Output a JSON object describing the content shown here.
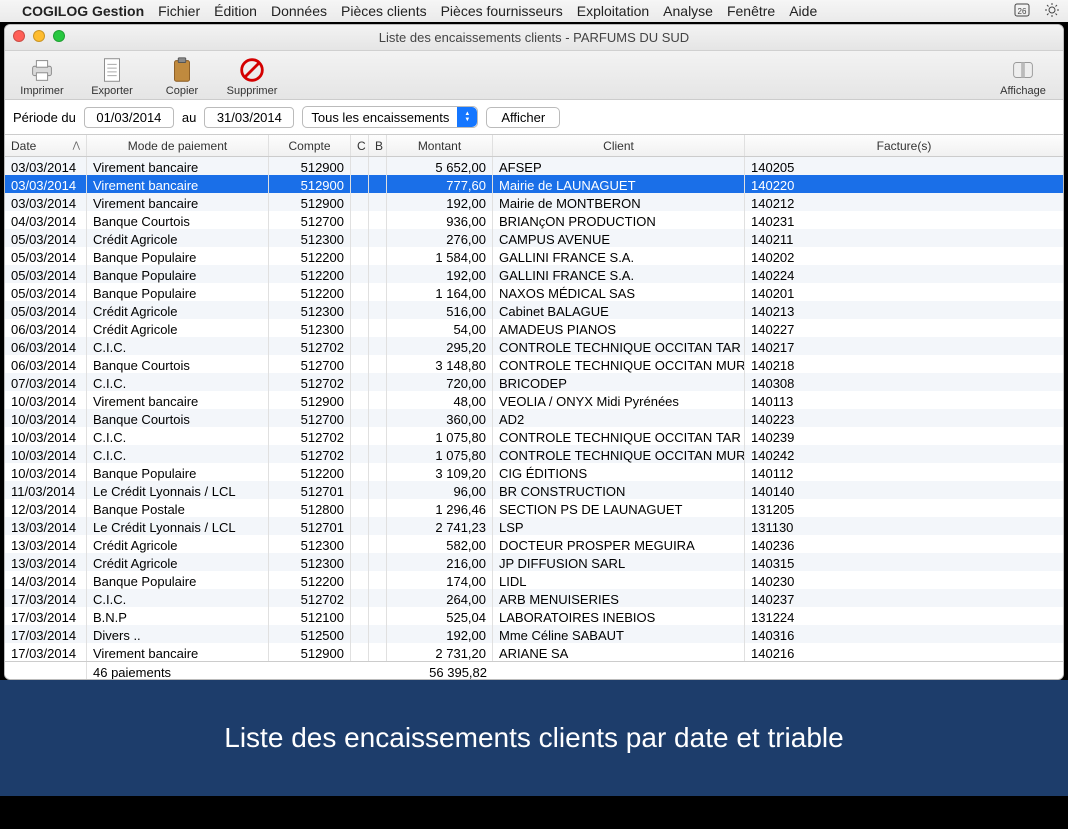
{
  "menubar": {
    "app": "COGILOG Gestion",
    "items": [
      "Fichier",
      "Édition",
      "Données",
      "Pièces clients",
      "Pièces fournisseurs",
      "Exploitation",
      "Analyse",
      "Fenêtre",
      "Aide"
    ]
  },
  "window": {
    "title": "Liste des encaissements clients - PARFUMS DU SUD"
  },
  "toolbar": {
    "print": "Imprimer",
    "export": "Exporter",
    "copy": "Copier",
    "delete": "Supprimer",
    "display": "Affichage"
  },
  "filters": {
    "label_from": "Période du",
    "date_from": "01/03/2014",
    "label_to": "au",
    "date_to": "31/03/2014",
    "filter_value": "Tous les encaissements",
    "show_btn": "Afficher"
  },
  "columns": {
    "date": "Date",
    "mode": "Mode de paiement",
    "compte": "Compte",
    "c": "C",
    "b": "B",
    "montant": "Montant",
    "client": "Client",
    "factures": "Facture(s)"
  },
  "rows": [
    {
      "date": "03/03/2014",
      "mode": "Virement bancaire",
      "compte": "512900",
      "montant": "5 652,00",
      "client": "AFSEP",
      "fact": "140205",
      "sel": false
    },
    {
      "date": "03/03/2014",
      "mode": "Virement bancaire",
      "compte": "512900",
      "montant": "777,60",
      "client": "Mairie de LAUNAGUET",
      "fact": "140220",
      "sel": true
    },
    {
      "date": "03/03/2014",
      "mode": "Virement bancaire",
      "compte": "512900",
      "montant": "192,00",
      "client": "Mairie de MONTBERON",
      "fact": "140212",
      "sel": false
    },
    {
      "date": "04/03/2014",
      "mode": "Banque Courtois",
      "compte": "512700",
      "montant": "936,00",
      "client": "BRIANçON PRODUCTION",
      "fact": "140231",
      "sel": false
    },
    {
      "date": "05/03/2014",
      "mode": "Crédit Agricole",
      "compte": "512300",
      "montant": "276,00",
      "client": "CAMPUS AVENUE",
      "fact": "140211",
      "sel": false
    },
    {
      "date": "05/03/2014",
      "mode": "Banque Populaire",
      "compte": "512200",
      "montant": "1 584,00",
      "client": "GALLINI FRANCE S.A.",
      "fact": "140202",
      "sel": false
    },
    {
      "date": "05/03/2014",
      "mode": "Banque Populaire",
      "compte": "512200",
      "montant": "192,00",
      "client": "GALLINI FRANCE S.A.",
      "fact": "140224",
      "sel": false
    },
    {
      "date": "05/03/2014",
      "mode": "Banque Populaire",
      "compte": "512200",
      "montant": "1 164,00",
      "client": "NAXOS MÉDICAL SAS",
      "fact": "140201",
      "sel": false
    },
    {
      "date": "05/03/2014",
      "mode": "Crédit Agricole",
      "compte": "512300",
      "montant": "516,00",
      "client": "Cabinet  BALAGUE",
      "fact": "140213",
      "sel": false
    },
    {
      "date": "06/03/2014",
      "mode": "Crédit Agricole",
      "compte": "512300",
      "montant": "54,00",
      "client": "AMADEUS PIANOS",
      "fact": "140227",
      "sel": false
    },
    {
      "date": "06/03/2014",
      "mode": "C.I.C.",
      "compte": "512702",
      "montant": "295,20",
      "client": "CONTROLE TECHNIQUE OCCITAN TAR",
      "fact": "140217",
      "sel": false
    },
    {
      "date": "06/03/2014",
      "mode": "Banque Courtois",
      "compte": "512700",
      "montant": "3 148,80",
      "client": "CONTROLE TECHNIQUE OCCITAN MUR",
      "fact": "140218",
      "sel": false
    },
    {
      "date": "07/03/2014",
      "mode": "C.I.C.",
      "compte": "512702",
      "montant": "720,00",
      "client": "BRICODEP",
      "fact": "140308",
      "sel": false
    },
    {
      "date": "10/03/2014",
      "mode": "Virement bancaire",
      "compte": "512900",
      "montant": "48,00",
      "client": "VEOLIA / ONYX Midi Pyrénées",
      "fact": "140113",
      "sel": false
    },
    {
      "date": "10/03/2014",
      "mode": "Banque Courtois",
      "compte": "512700",
      "montant": "360,00",
      "client": "AD2",
      "fact": "140223",
      "sel": false
    },
    {
      "date": "10/03/2014",
      "mode": "C.I.C.",
      "compte": "512702",
      "montant": "1 075,80",
      "client": "CONTROLE TECHNIQUE OCCITAN TAR",
      "fact": "140239",
      "sel": false
    },
    {
      "date": "10/03/2014",
      "mode": "C.I.C.",
      "compte": "512702",
      "montant": "1 075,80",
      "client": "CONTROLE TECHNIQUE OCCITAN MUR",
      "fact": "140242",
      "sel": false
    },
    {
      "date": "10/03/2014",
      "mode": "Banque Populaire",
      "compte": "512200",
      "montant": "3 109,20",
      "client": "CIG ÉDITIONS",
      "fact": "140112",
      "sel": false
    },
    {
      "date": "11/03/2014",
      "mode": "Le Crédit Lyonnais / LCL",
      "compte": "512701",
      "montant": "96,00",
      "client": "BR CONSTRUCTION",
      "fact": "140140",
      "sel": false
    },
    {
      "date": "12/03/2014",
      "mode": "Banque Postale",
      "compte": "512800",
      "montant": "1 296,46",
      "client": "SECTION PS DE LAUNAGUET",
      "fact": "131205",
      "sel": false
    },
    {
      "date": "13/03/2014",
      "mode": "Le Crédit Lyonnais / LCL",
      "compte": "512701",
      "montant": "2 741,23",
      "client": "LSP",
      "fact": "131130",
      "sel": false
    },
    {
      "date": "13/03/2014",
      "mode": "Crédit Agricole",
      "compte": "512300",
      "montant": "582,00",
      "client": "DOCTEUR PROSPER MEGUIRA",
      "fact": "140236",
      "sel": false
    },
    {
      "date": "13/03/2014",
      "mode": "Crédit Agricole",
      "compte": "512300",
      "montant": "216,00",
      "client": "JP DIFFUSION SARL",
      "fact": "140315",
      "sel": false
    },
    {
      "date": "14/03/2014",
      "mode": "Banque Populaire",
      "compte": "512200",
      "montant": "174,00",
      "client": "LIDL",
      "fact": "140230",
      "sel": false
    },
    {
      "date": "17/03/2014",
      "mode": "C.I.C.",
      "compte": "512702",
      "montant": "264,00",
      "client": "ARB MENUISERIES",
      "fact": "140237",
      "sel": false
    },
    {
      "date": "17/03/2014",
      "mode": "B.N.P",
      "compte": "512100",
      "montant": "525,04",
      "client": "LABORATOIRES INEBIOS",
      "fact": "131224",
      "sel": false
    },
    {
      "date": "17/03/2014",
      "mode": "Divers ..",
      "compte": "512500",
      "montant": "192,00",
      "client": "Mme Céline SABAUT",
      "fact": "140316",
      "sel": false
    },
    {
      "date": "17/03/2014",
      "mode": "Virement bancaire",
      "compte": "512900",
      "montant": "2 731,20",
      "client": "ARIANE SA",
      "fact": "140216",
      "sel": false
    }
  ],
  "footer": {
    "count": "46 paiements",
    "total": "56 395,82"
  },
  "caption": "Liste des encaissements clients par date et triable"
}
